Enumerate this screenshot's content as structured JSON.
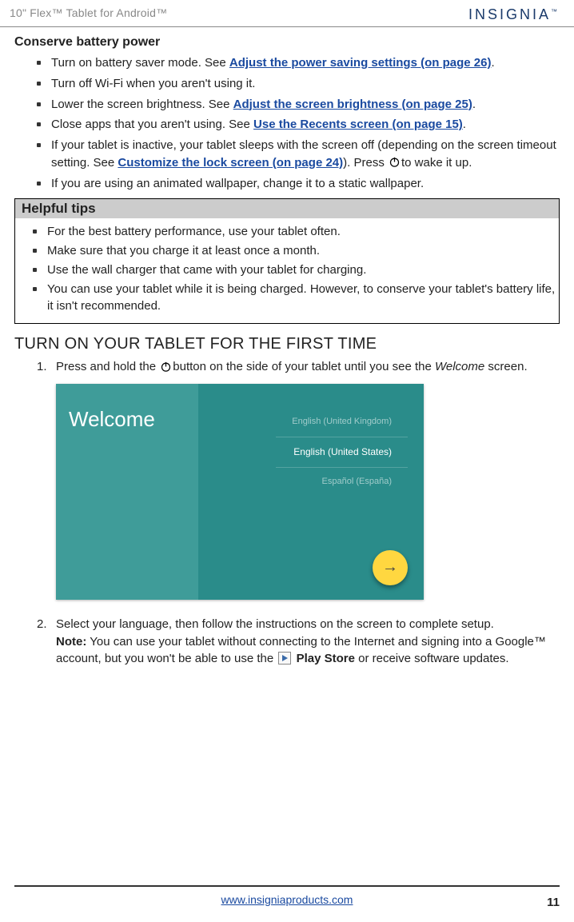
{
  "header": {
    "title": "10\" Flex™ Tablet for Android™",
    "brand": "INSIGNIA"
  },
  "conserve": {
    "heading": "Conserve battery power",
    "item1_a": "Turn on battery saver mode. See ",
    "item1_link": "Adjust the power saving settings (on page 26)",
    "item1_b": ".",
    "item2": "Turn off Wi-Fi when you aren't using it.",
    "item3_a": "Lower the screen brightness. See ",
    "item3_link": "Adjust the screen brightness (on page 25)",
    "item3_b": ".",
    "item4_a": "Close apps that you aren't using. See ",
    "item4_link": "Use the Recents screen (on page 15)",
    "item4_b": ".",
    "item5_a": "If your tablet is inactive, your tablet sleeps with the screen off (depending on the screen timeout setting. See ",
    "item5_link": "Customize the lock screen (on page 24)",
    "item5_b": "). Press ",
    "item5_c": "to wake it up.",
    "item6": "If you are using an animated wallpaper, change it to a static wallpaper."
  },
  "tips": {
    "heading": "Helpful tips",
    "t1": "For the best battery performance, use your tablet often.",
    "t2": "Make sure that you charge it at least once a month.",
    "t3": "Use the wall charger that came with your tablet for charging.",
    "t4": "You can use your tablet while it is being charged. However, to conserve your tablet's battery life, it isn't recommended."
  },
  "firsttime": {
    "heading": "TURN ON YOUR TABLET FOR THE FIRST TIME",
    "step1_a": "Press and hold the ",
    "step1_b": "button on the side of your tablet until you see the ",
    "step1_welcome": "Welcome",
    "step1_c": " screen.",
    "welcome_label": "Welcome",
    "lang1": "English (United Kingdom)",
    "lang2": "English (United States)",
    "lang3": "Español (España)",
    "step2_a": "Select your language, then follow the instructions on the screen to complete setup.",
    "step2_note_label": "Note:",
    "step2_note_a": " You can use your tablet without connecting to the Internet and signing into a Google™ account, but you won't be able to use the ",
    "step2_playstore": "Play Store",
    "step2_note_b": " or receive software updates."
  },
  "footer": {
    "url": "www.insigniaproducts.com",
    "page": "11"
  }
}
